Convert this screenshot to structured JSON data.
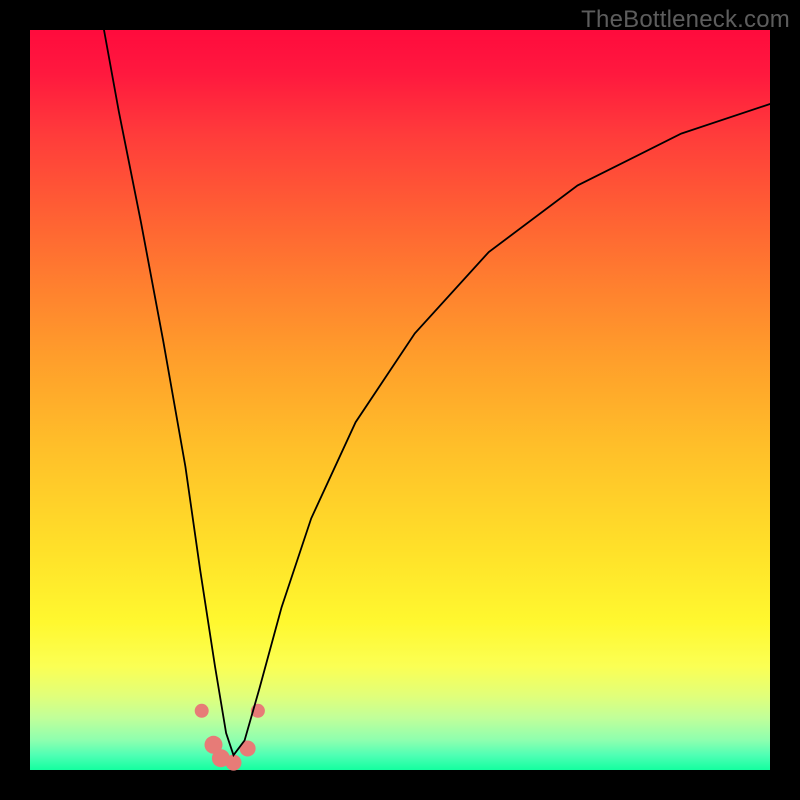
{
  "watermark": "TheBottleneck.com",
  "colors": {
    "gradient_top": "#ff0b3d",
    "gradient_bottom": "#14ffa0",
    "curve": "#000000",
    "markers": "#e77b77",
    "background": "#000000"
  },
  "chart_data": {
    "type": "line",
    "title": "",
    "xlabel": "",
    "ylabel": "",
    "xlim": [
      0,
      100
    ],
    "ylim": [
      0,
      100
    ],
    "note": "Axes are unlabeled in the source image; x/y values are relative estimates (0–100) read from pixel positions. The curve dips to roughly y≈1 (bottom) near x≈27 then rises back toward the top-right.",
    "series": [
      {
        "name": "bottleneck-curve",
        "x": [
          10,
          12,
          15,
          18,
          21,
          23,
          25,
          26.5,
          27.5,
          29,
          31,
          34,
          38,
          44,
          52,
          62,
          74,
          88,
          100
        ],
        "y": [
          100,
          89,
          74,
          58,
          41,
          27,
          14,
          5,
          2,
          4,
          11,
          22,
          34,
          47,
          59,
          70,
          79,
          86,
          90
        ]
      }
    ],
    "markers": {
      "name": "highlight-points",
      "x": [
        23.2,
        24.8,
        25.8,
        27.5,
        29.4,
        30.8
      ],
      "y": [
        8.0,
        3.4,
        1.6,
        1.0,
        2.9,
        8.0
      ],
      "r": [
        7,
        9,
        9,
        8,
        8,
        7
      ]
    }
  }
}
